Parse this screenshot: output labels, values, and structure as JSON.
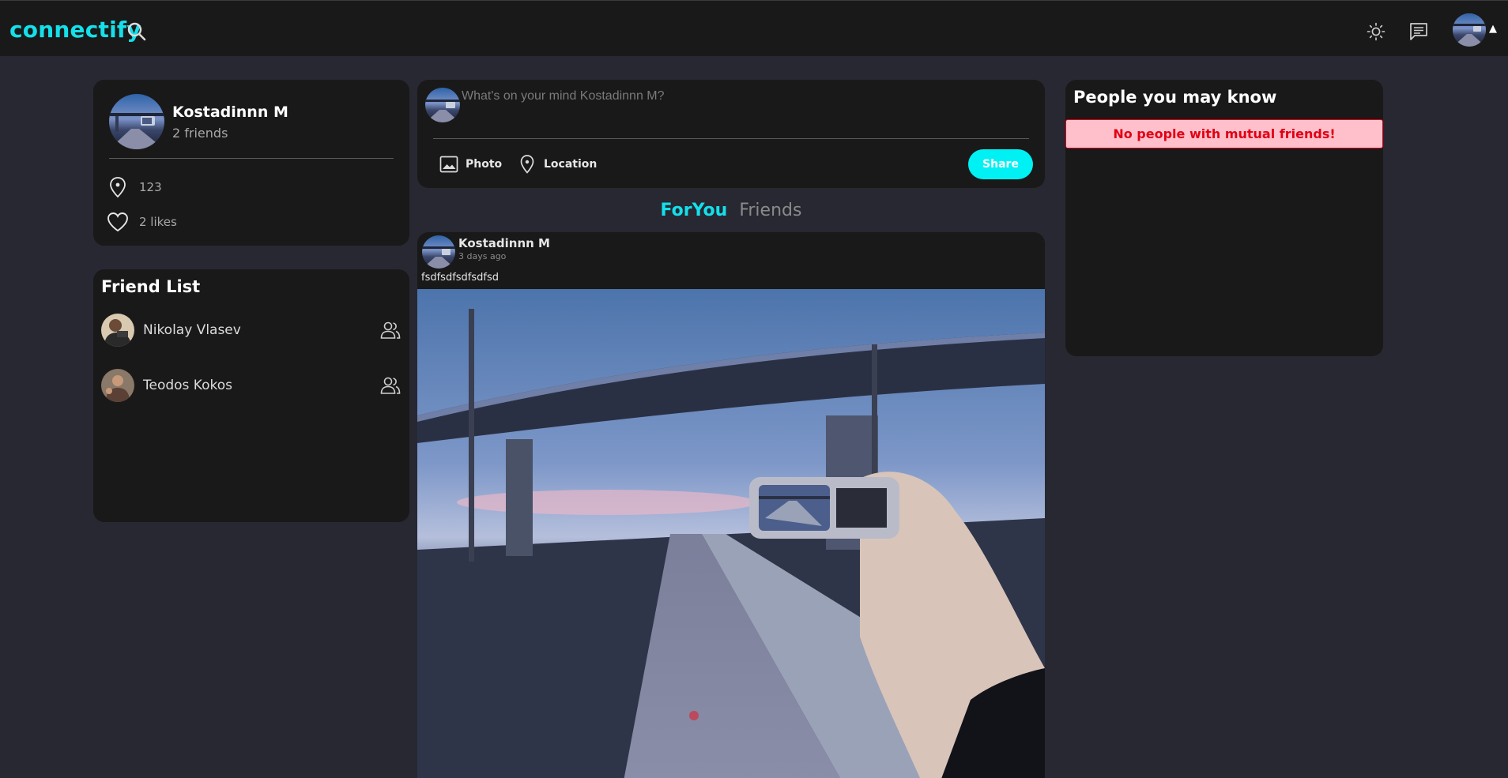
{
  "nav": {
    "logo": "connectify",
    "icons": {
      "search": "search-icon",
      "theme": "sun-icon",
      "messages": "chat-icon",
      "caret": "caret-up-icon"
    },
    "caret_glyph": "▲"
  },
  "profile": {
    "name": "Kostadinnn M",
    "friends": "2 friends",
    "location": "123",
    "likes": "2 likes"
  },
  "friend_list": {
    "title": "Friend List",
    "items": [
      {
        "name": "Nikolay Vlasev",
        "action_icon": "friend-icon"
      },
      {
        "name": "Teodos Kokos",
        "action_icon": "friend-icon"
      }
    ]
  },
  "composer": {
    "placeholder": "What's on your mind Kostadinnn M?",
    "photo_label": "Photo",
    "location_label": "Location",
    "share_label": "Share"
  },
  "feed_tabs": {
    "active": "ForYou",
    "inactive": "Friends"
  },
  "post": {
    "author": "Kostadinnn M",
    "time": "3 days ago",
    "text": "fsdfsdfsdfsdfsd"
  },
  "people": {
    "title": "People you may know",
    "alert": "No people with mutual friends!"
  },
  "colors": {
    "accent": "#14e0ea",
    "share_button": "#00f1f4",
    "background": "#272832",
    "card": "#191919",
    "alert_bg": "#ffc0cc",
    "alert_text": "#e00014"
  }
}
